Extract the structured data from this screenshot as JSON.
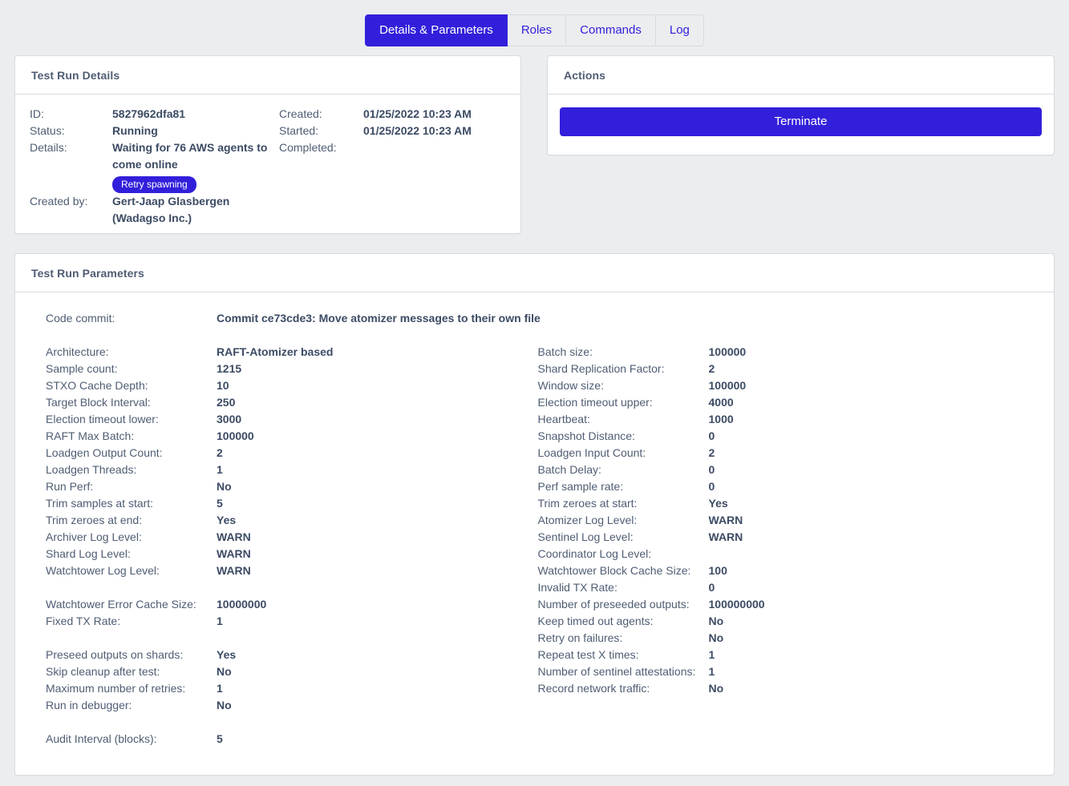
{
  "tabs": [
    {
      "label": "Details & Parameters",
      "active": true
    },
    {
      "label": "Roles",
      "active": false
    },
    {
      "label": "Commands",
      "active": false
    },
    {
      "label": "Log",
      "active": false
    }
  ],
  "details_card": {
    "title": "Test Run Details",
    "fields": {
      "id_label": "ID:",
      "id_value": "5827962dfa81",
      "status_label": "Status:",
      "status_value": "Running",
      "details_label": "Details:",
      "details_value": "Waiting for 76 AWS agents to come online",
      "retry_badge": "Retry spawning",
      "created_by_label": "Created by:",
      "created_by_value": "Gert-Jaap Glasbergen (Wadagso Inc.)",
      "created_label": "Created:",
      "created_value": "01/25/2022 10:23 AM",
      "started_label": "Started:",
      "started_value": "01/25/2022 10:23 AM",
      "completed_label": "Completed:",
      "completed_value": ""
    }
  },
  "actions_card": {
    "title": "Actions",
    "terminate_label": "Terminate"
  },
  "parameters_card": {
    "title": "Test Run Parameters",
    "commit_label": "Code commit:",
    "commit_value": "Commit ce73cde3: Move atomizer messages to their own file",
    "left_column": [
      {
        "label": "Architecture:",
        "value": "RAFT-Atomizer based"
      },
      {
        "label": "Sample count:",
        "value": "1215"
      },
      {
        "label": "STXO Cache Depth:",
        "value": "10"
      },
      {
        "label": "Target Block Interval:",
        "value": "250"
      },
      {
        "label": "Election timeout lower:",
        "value": "3000"
      },
      {
        "label": "RAFT Max Batch:",
        "value": "100000"
      },
      {
        "label": "Loadgen Output Count:",
        "value": "2"
      },
      {
        "label": "Loadgen Threads:",
        "value": "1"
      },
      {
        "label": "Run Perf:",
        "value": "No"
      },
      {
        "label": "Trim samples at start:",
        "value": "5"
      },
      {
        "label": "Trim zeroes at end:",
        "value": "Yes"
      },
      {
        "label": "Archiver Log Level:",
        "value": "WARN"
      },
      {
        "label": "Shard Log Level:",
        "value": "WARN"
      },
      {
        "label": "Watchtower Log Level:",
        "value": "WARN"
      },
      {
        "gap": true
      },
      {
        "label": "Watchtower Error Cache Size:",
        "value": "10000000"
      },
      {
        "label": "Fixed TX Rate:",
        "value": "1"
      },
      {
        "gap": true
      },
      {
        "label": "Preseed outputs on shards:",
        "value": "Yes"
      },
      {
        "label": "Skip cleanup after test:",
        "value": "No"
      },
      {
        "label": "Maximum number of retries:",
        "value": "1"
      },
      {
        "label": "Run in debugger:",
        "value": "No"
      },
      {
        "gap": true
      },
      {
        "label": "Audit Interval (blocks):",
        "value": "5"
      }
    ],
    "right_column": [
      {
        "label": "Batch size:",
        "value": "100000"
      },
      {
        "label": "Shard Replication Factor:",
        "value": "2"
      },
      {
        "label": "Window size:",
        "value": "100000"
      },
      {
        "label": "Election timeout upper:",
        "value": "4000"
      },
      {
        "label": "Heartbeat:",
        "value": "1000"
      },
      {
        "label": "Snapshot Distance:",
        "value": "0"
      },
      {
        "label": "Loadgen Input Count:",
        "value": "2"
      },
      {
        "label": "Batch Delay:",
        "value": "0"
      },
      {
        "label": "Perf sample rate:",
        "value": "0"
      },
      {
        "label": "Trim zeroes at start:",
        "value": "Yes"
      },
      {
        "label": "Atomizer Log Level:",
        "value": "WARN"
      },
      {
        "label": "Sentinel Log Level:",
        "value": "WARN"
      },
      {
        "label": "Coordinator Log Level:",
        "value": ""
      },
      {
        "label": "Watchtower Block Cache Size:",
        "value": "100"
      },
      {
        "label": "Invalid TX Rate:",
        "value": "0"
      },
      {
        "label": "Number of preseeded outputs:",
        "value": "100000000"
      },
      {
        "label": "Keep timed out agents:",
        "value": "No"
      },
      {
        "label": "Retry on failures:",
        "value": "No"
      },
      {
        "label": "Repeat test X times:",
        "value": "1"
      },
      {
        "label": "Number of sentinel attestations:",
        "value": "1"
      },
      {
        "label": "Record network traffic:",
        "value": "No"
      }
    ]
  },
  "colors": {
    "accent": "#321fdb",
    "page_background": "#ebedef",
    "card_border": "#d8dbe0",
    "label_text": "#4f5d73",
    "value_text": "#3c4b64"
  }
}
